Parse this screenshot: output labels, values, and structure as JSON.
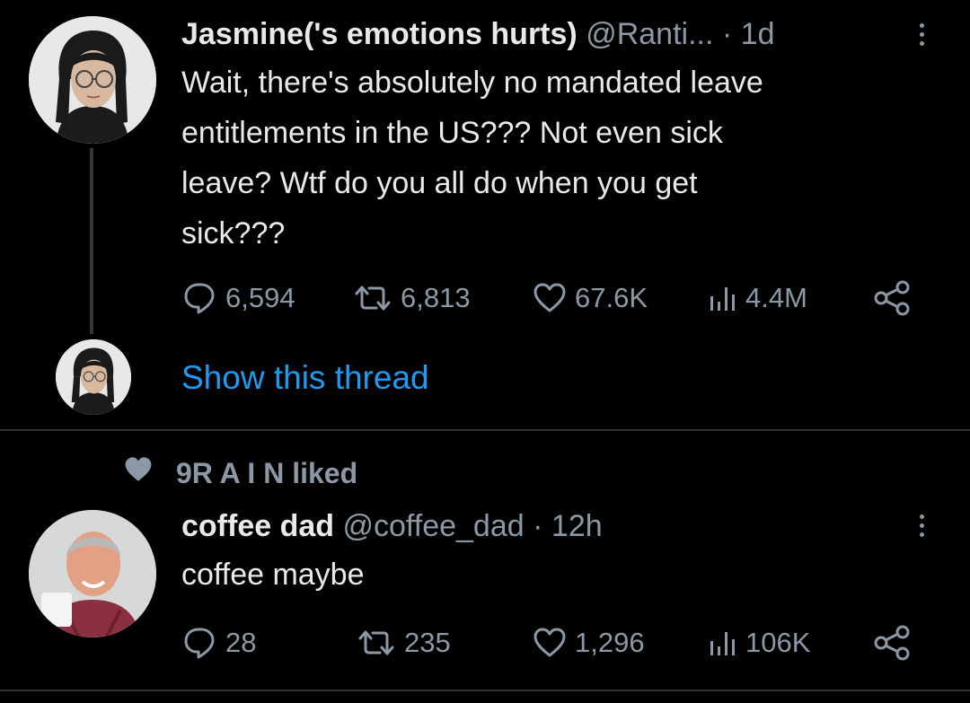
{
  "tweet1": {
    "display_name": "Jasmine('s emotions hurts)",
    "handle": "@Ranti...",
    "separator": "·",
    "time": "1d",
    "text_lines": [
      "Wait, there's absolutely no mandated leave",
      "entitlements in the US??? Not even sick",
      "leave? Wtf do you all do when you get",
      "sick???"
    ],
    "stats": {
      "replies": "6,594",
      "retweets": "6,813",
      "likes": "67.6K",
      "views": "4.4M"
    },
    "show_thread": "Show this thread"
  },
  "social_context": {
    "icon": "heart-icon",
    "text": "9R A I N liked"
  },
  "tweet2": {
    "display_name": "coffee dad",
    "handle": "@coffee_dad",
    "separator": "·",
    "time": "12h",
    "text": "coffee maybe",
    "stats": {
      "replies": "28",
      "retweets": "235",
      "likes": "1,296",
      "views": "106K"
    }
  },
  "colors": {
    "background": "#000000",
    "text": "#e7e9ea",
    "muted": "#8b98a5",
    "link": "#1d9bf0",
    "divider": "#2f3336"
  }
}
